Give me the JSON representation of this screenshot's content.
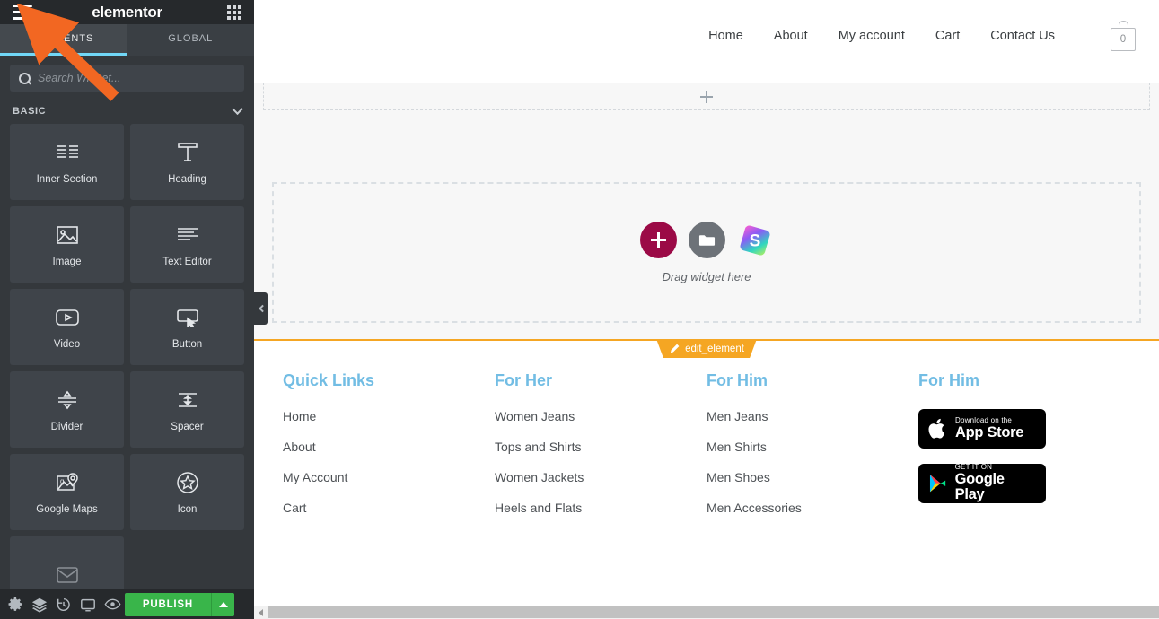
{
  "panel": {
    "brand": "elementor",
    "menu_icon": "hamburger-icon",
    "apps_icon": "grid-dots-icon",
    "tabs": [
      {
        "label": "ELEMENTS",
        "active": true
      },
      {
        "label": "GLOBAL",
        "active": false
      }
    ],
    "search": {
      "placeholder": "Search Widget...",
      "value": ""
    },
    "category": {
      "label": "BASIC",
      "expanded": true
    },
    "widgets": [
      {
        "label": "Inner Section",
        "icon": "columns-icon"
      },
      {
        "label": "Heading",
        "icon": "heading-t-icon"
      },
      {
        "label": "Image",
        "icon": "image-icon"
      },
      {
        "label": "Text Editor",
        "icon": "text-lines-icon"
      },
      {
        "label": "Video",
        "icon": "video-play-icon"
      },
      {
        "label": "Button",
        "icon": "button-cursor-icon"
      },
      {
        "label": "Divider",
        "icon": "divider-icon"
      },
      {
        "label": "Spacer",
        "icon": "spacer-icon"
      },
      {
        "label": "Google Maps",
        "icon": "map-pin-icon"
      },
      {
        "label": "Icon",
        "icon": "star-circle-icon"
      }
    ],
    "footer": {
      "icons": [
        "settings-gear-icon",
        "navigator-layers-icon",
        "history-clock-icon",
        "responsive-monitor-icon",
        "preview-eye-icon"
      ],
      "publish_label": "PUBLISH",
      "publish_dropdown_icon": "caret-up-icon"
    },
    "collapse_icon": "chevron-left-icon"
  },
  "canvas": {
    "site_nav": [
      {
        "label": "Home"
      },
      {
        "label": "About"
      },
      {
        "label": "My account"
      },
      {
        "label": "Cart"
      },
      {
        "label": "Contact Us"
      }
    ],
    "cart": {
      "count": "0",
      "icon": "shopping-bag-icon"
    },
    "add_section_icon": "plus-icon",
    "drop_zone": {
      "label": "Drag widget here",
      "add_button_icon": "plus-icon",
      "folder_button_icon": "folder-icon",
      "stratum_button_icon": "stratum-s-logo-icon"
    },
    "edit_tag": {
      "label": "edit_element",
      "icon": "pencil-icon"
    },
    "footer_columns": [
      {
        "title": "Quick Links",
        "links": [
          "Home",
          "About",
          "My Account",
          "Cart"
        ]
      },
      {
        "title": "For Her",
        "links": [
          "Women Jeans",
          "Tops and Shirts",
          "Women Jackets",
          "Heels and Flats"
        ]
      },
      {
        "title": "For Him",
        "links": [
          "Men Jeans",
          "Men Shirts",
          "Men Shoes",
          "Men Accessories"
        ]
      },
      {
        "title": "For Him",
        "links": [],
        "badges": [
          {
            "small": "Download on the",
            "big": "App Store",
            "icon": "apple-logo-icon"
          },
          {
            "small": "GET IT ON",
            "big": "Google Play",
            "icon": "google-play-icon"
          }
        ]
      }
    ]
  },
  "scrollbar": {
    "left_arrow_icon": "triangle-left-icon"
  },
  "annotation": {
    "type": "arrow",
    "color": "#f26722",
    "points_to": "hamburger-icon"
  },
  "colors": {
    "panel_bg": "#34383c",
    "panel_header_bg": "#26292c",
    "tab_active_underline": "#71d7f7",
    "publish_green": "#39b54a",
    "edit_tag_orange": "#f5a623",
    "footer_heading_blue": "#72bde4",
    "add_button_magenta": "#9b0a46",
    "annotation_orange": "#f26722"
  }
}
